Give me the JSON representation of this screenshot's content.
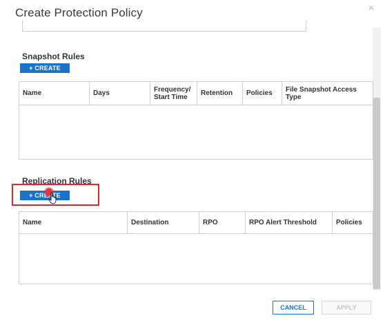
{
  "dialog": {
    "title": "Create Protection Policy",
    "close_glyph": "×"
  },
  "snapshot": {
    "title": "Snapshot Rules",
    "create_label": "+ CREATE",
    "columns": [
      "Name",
      "Days",
      "Frequency/ Start Time",
      "Retention",
      "Policies",
      "File Snapshot Access Type"
    ]
  },
  "replication": {
    "title": "Replication Rules",
    "create_label": "+ CREATE",
    "columns": [
      "Name",
      "Destination",
      "RPO",
      "RPO Alert Threshold",
      "Policies"
    ]
  },
  "footer": {
    "cancel_label": "CANCEL",
    "apply_label": "APPLY"
  },
  "colors": {
    "accent": "#1a73c8",
    "highlight": "#e0262b"
  },
  "icons": [
    "close-icon",
    "hand-pointer-icon"
  ]
}
